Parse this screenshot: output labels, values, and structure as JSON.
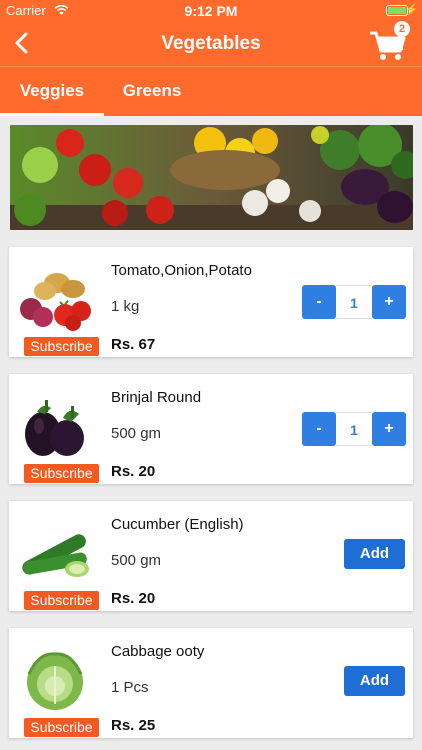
{
  "status_bar": {
    "carrier": "Carrier",
    "time": "9:12 PM"
  },
  "header": {
    "title": "Vegetables",
    "cart_count": "2"
  },
  "tabs": [
    {
      "label": "Veggies",
      "active": true
    },
    {
      "label": "Greens",
      "active": false
    }
  ],
  "products": [
    {
      "name": "Tomato,Onion,Potato",
      "quantity": "1 kg",
      "price": "Rs. 67",
      "subscribe_label": "Subscribe",
      "control": "stepper",
      "count": "1",
      "minus": "-",
      "plus": "+"
    },
    {
      "name": "Brinjal Round",
      "quantity": "500 gm",
      "price": "Rs. 20",
      "subscribe_label": "Subscribe",
      "control": "stepper",
      "count": "1",
      "minus": "-",
      "plus": "+"
    },
    {
      "name": "Cucumber (English)",
      "quantity": "500 gm",
      "price": "Rs. 20",
      "subscribe_label": "Subscribe",
      "control": "add",
      "add_label": "Add"
    },
    {
      "name": "Cabbage ooty",
      "quantity": "1 Pcs",
      "price": "Rs. 25",
      "subscribe_label": "Subscribe",
      "control": "add",
      "add_label": "Add"
    }
  ],
  "colors": {
    "brand": "#ff6a2d",
    "button_blue": "#2f7fe2",
    "subscribe": "#f25a22"
  }
}
